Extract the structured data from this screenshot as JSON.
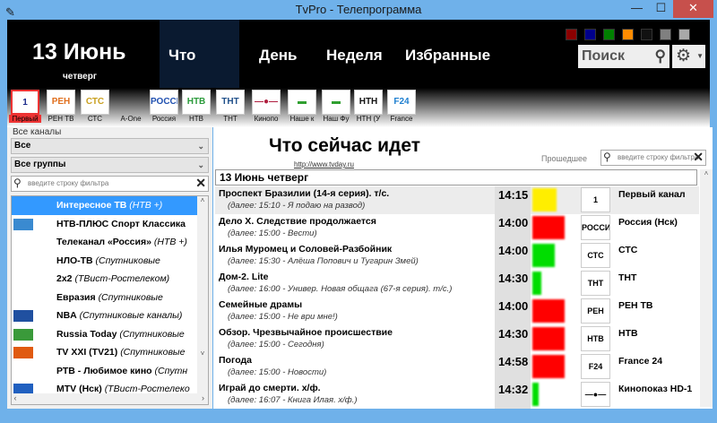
{
  "window": {
    "title": "TvPro - Телепрограмма",
    "minimize": "—",
    "maximize": "☐",
    "close": "✕"
  },
  "header": {
    "date": "13 Июнь",
    "weekday": "четверг",
    "tabs": [
      {
        "label": "Что идет",
        "active": true
      },
      {
        "label": "День"
      },
      {
        "label": "Неделя"
      },
      {
        "label": "Избранные"
      }
    ],
    "swatches": [
      "#8b0000",
      "#00008b",
      "#008000",
      "#ff8c00",
      "#111111",
      "#808080",
      "#a9a9a9"
    ],
    "search_placeholder": "Поиск"
  },
  "channels": [
    {
      "label": "Первый",
      "logo": "1",
      "color": "#1a2a8a",
      "selected": true
    },
    {
      "label": "РЕН ТВ",
      "logo": "РЕН",
      "color": "#e07020"
    },
    {
      "label": "СТС",
      "logo": "СТС",
      "color": "#c9a020"
    },
    {
      "label": "A-One",
      "logo": "",
      "color": "#fff"
    },
    {
      "label": "Россия",
      "logo": "РОССИЯ",
      "color": "#2050b0"
    },
    {
      "label": "НТВ",
      "logo": "НТВ",
      "color": "#2a9a3a"
    },
    {
      "label": "ТНТ",
      "logo": "ТНТ",
      "color": "#20508a"
    },
    {
      "label": "Кинопо",
      "logo": "—●—",
      "color": "#b02040"
    },
    {
      "label": "Наше к",
      "logo": "▬",
      "color": "#30a030"
    },
    {
      "label": "Наш Фу",
      "logo": "▬",
      "color": "#30a030"
    },
    {
      "label": "НТН (У",
      "logo": "НТН",
      "color": "#111"
    },
    {
      "label": "France",
      "logo": "F24",
      "color": "#2080d0"
    }
  ],
  "sidebar": {
    "group_label": "Все каналы",
    "channel_select": "Все",
    "group_select": "Все группы",
    "filter_placeholder": "введите строку фильтра",
    "items": [
      {
        "name": "Интересное ТВ",
        "group": "(НТВ +)",
        "selected": true,
        "icon": ""
      },
      {
        "name": "НТВ-ПЛЮС Спорт Классика",
        "group": "",
        "icon": "ntv-plus-icon",
        "icolor": "#3a8ad0"
      },
      {
        "name": "Телеканал «Россия»",
        "group": "(НТВ +)",
        "icon": ""
      },
      {
        "name": "НЛО-ТВ",
        "group": "(Спутниковые",
        "icon": ""
      },
      {
        "name": "2x2",
        "group": "(ТВист-Ростелеком)",
        "icon": ""
      },
      {
        "name": "Евразия",
        "group": "(Спутниковые",
        "icon": ""
      },
      {
        "name": "NBA",
        "group": "(Спутниковые каналы)",
        "icon": "nba-icon",
        "icolor": "#2050a0"
      },
      {
        "name": "Russia Today",
        "group": "(Спутниковые",
        "icon": "rt-icon",
        "icolor": "#3a9a3a"
      },
      {
        "name": "TV XXI (TV21)",
        "group": "(Спутниковые",
        "icon": "tv21-icon",
        "icolor": "#e05a10"
      },
      {
        "name": "РТВ - Любимое кино",
        "group": "(Спутн",
        "icon": ""
      },
      {
        "name": "MTV (Нск)",
        "group": "(ТВист-Ростелеко",
        "icon": "mtv-icon",
        "icolor": "#2060c0"
      }
    ]
  },
  "main": {
    "title": "Что сейчас идет",
    "url": "http://www.tvday.ru",
    "past_label": "Прошедшее",
    "filter_placeholder": "введите строку фильтра",
    "day_header": "13 Июнь четверг",
    "rows": [
      {
        "title": "Проспект Бразилии (14-я серия). т/с.",
        "next": "(далее: 15:10 - Я подаю на развод)",
        "time": "14:15",
        "progress": 0.75,
        "status_color": "#ffee00",
        "channel": "Первый канал",
        "logo": "1"
      },
      {
        "title": "Дело Х. Следствие продолжается",
        "next": "(далее: 15:00 - Вести)",
        "time": "14:00",
        "progress": 1.0,
        "status_color": "#ff0000",
        "channel": "Россия (Нск)",
        "logo": "РОССИЯ"
      },
      {
        "title": "Илья Муромец и Соловей-Разбойник",
        "next": "(далее: 15:30 - Алёша Попович и Тугарин Змей)",
        "time": "14:00",
        "progress": 0.7,
        "status_color": "#00dd00",
        "channel": "СТС",
        "logo": "СТС"
      },
      {
        "title": "Дом-2. Lite",
        "next": "(далее: 16:00 - Универ. Новая общага (67-я серия). т/с.)",
        "time": "14:30",
        "progress": 0.28,
        "status_color": "#00dd00",
        "channel": "ТНТ",
        "logo": "ТНТ"
      },
      {
        "title": "Семейные драмы",
        "next": "(далее: 15:00 - Не ври мне!)",
        "time": "14:00",
        "progress": 1.0,
        "status_color": "#ff0000",
        "channel": "РЕН ТВ",
        "logo": "РЕН"
      },
      {
        "title": "Обзор. Чрезвычайное происшествие",
        "next": "(далее: 15:00 - Сегодня)",
        "time": "14:30",
        "progress": 1.0,
        "status_color": "#ff0000",
        "channel": "НТВ",
        "logo": "НТВ"
      },
      {
        "title": "Погода",
        "next": "(далее: 15:00 - Новости)",
        "time": "14:58",
        "progress": 1.0,
        "status_color": "#ff0000",
        "channel": "France 24",
        "logo": "F24"
      },
      {
        "title": "Играй до смерти. х/ф.",
        "next": "(далее: 16:07 - Книга Илая. х/ф.)",
        "time": "14:32",
        "progress": 0.2,
        "status_color": "#00dd00",
        "channel": "Кинопоказ HD-1",
        "logo": "—●—"
      }
    ]
  }
}
